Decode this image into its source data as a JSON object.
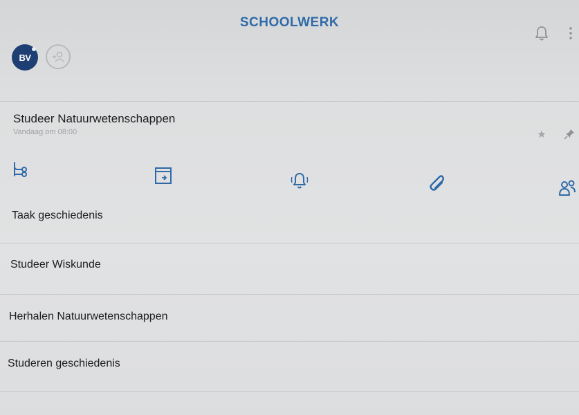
{
  "header": {
    "title": "SCHOOLWERK",
    "avatar_initials": "BV"
  },
  "expanded_task": {
    "title": "Studeer Natuurwetenschappen",
    "subtitle": "Vandaag om 08:00"
  },
  "tasks": [
    {
      "label": "Taak geschiedenis"
    },
    {
      "label": "Studeer Wiskunde"
    },
    {
      "label": "Herhalen Natuurwetenschappen"
    },
    {
      "label": "Studeren geschiedenis"
    }
  ],
  "colors": {
    "accent": "#2f6aa8",
    "avatar_bg": "#1d3f73"
  },
  "icons": {
    "header": [
      "bell-icon",
      "more-vertical-icon"
    ],
    "task_meta": [
      "star-icon",
      "pin-icon"
    ],
    "task_actions": [
      "subtasks-icon",
      "calendar-icon",
      "reminder-bell-icon",
      "attachment-icon",
      "assign-users-icon"
    ]
  }
}
